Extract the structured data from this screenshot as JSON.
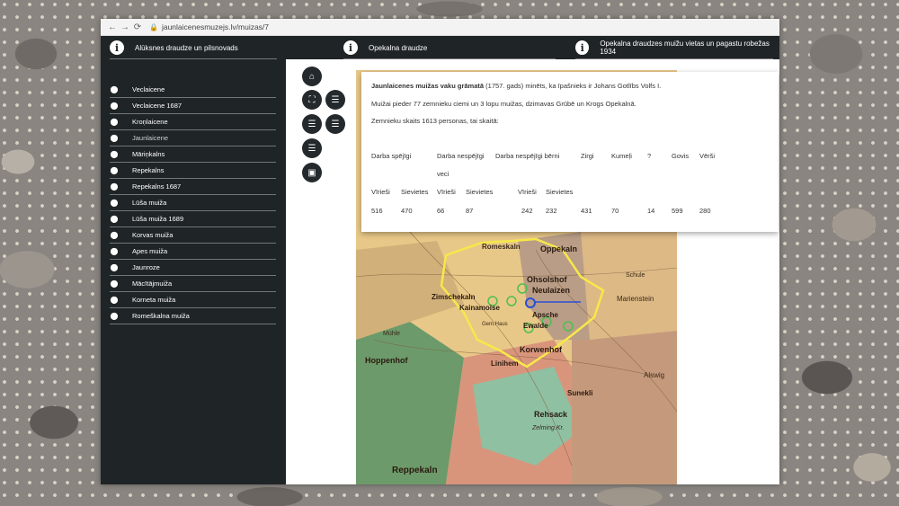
{
  "browser": {
    "url": "jaunlaicenesmuzejs.lv/muizas/7"
  },
  "topbar": {
    "sections": [
      {
        "label": "Alūksnes draudze un pilsnovads"
      },
      {
        "label": "Opekalna draudze"
      },
      {
        "label": "Opekalna draudzes muižu vietas un pagastu robežas 1934"
      }
    ]
  },
  "sidebar": {
    "items": [
      {
        "label": "Veclaicene"
      },
      {
        "label": "Veclaicene 1687"
      },
      {
        "label": "Kroņlaicene"
      },
      {
        "label": "Jaunlaicene"
      },
      {
        "label": "Māriņkalns"
      },
      {
        "label": "Repekalns"
      },
      {
        "label": "Repekalns 1687"
      },
      {
        "label": "Lūša muiža"
      },
      {
        "label": "Lūša muiža 1689"
      },
      {
        "label": "Korvas muiža"
      },
      {
        "label": "Apes muiža"
      },
      {
        "label": "Jaunroze"
      },
      {
        "label": "Mācītājmuiža"
      },
      {
        "label": "Korneta muiža"
      },
      {
        "label": "Romeškalna muiža"
      }
    ]
  },
  "info": {
    "title": "Jaunlaicenes muižas vaku grāmatā",
    "intro_rest": " (1757. gads) minēts, ka īpašnieks ir Johans Gotlībs Volfs I.",
    "line2": "Muižai pieder 77 zemnieku ciemi un 3 lopu muižas, dzimavas Grūbē un Krogs Opekalnā.",
    "line3": "Zemnieku  skaits 1613 personas, tai skaitā:",
    "headers": [
      "Darba spējīgi",
      "Darba nespējīgi",
      "veci",
      "Darba nespējīgi bērni",
      "Zirgi",
      "Kumeļi",
      "?",
      "Govis",
      "Vērši"
    ],
    "subheaders": [
      "Vīrieši",
      "Sievietes",
      "Vīrieši",
      "Sievietes",
      "Vīrieši",
      "Sievietes"
    ],
    "values": [
      "516",
      "470",
      "66",
      "87",
      "242",
      "232",
      "431",
      "70",
      "14",
      "599",
      "280"
    ]
  },
  "map_labels": [
    "Romeskaln",
    "Oppekaln",
    "Ohsolshof",
    "Neulaizen",
    "Schule",
    "Marienstein",
    "Zimschekaln",
    "Kainamoise",
    "Gem.Haus",
    "Apsche",
    "Ewalde",
    "Mühle",
    "Korwenhof",
    "Linihem",
    "Hoppenhof",
    "Rehsack",
    "Sunekli",
    "Alswig",
    "Zelming.Kr.",
    "Reppekaln"
  ],
  "colors": {
    "dark": "#1f2427",
    "boundary": "#f7e84a",
    "manor_marker": "#4fbf4f",
    "current_marker": "#2a4fd6"
  }
}
